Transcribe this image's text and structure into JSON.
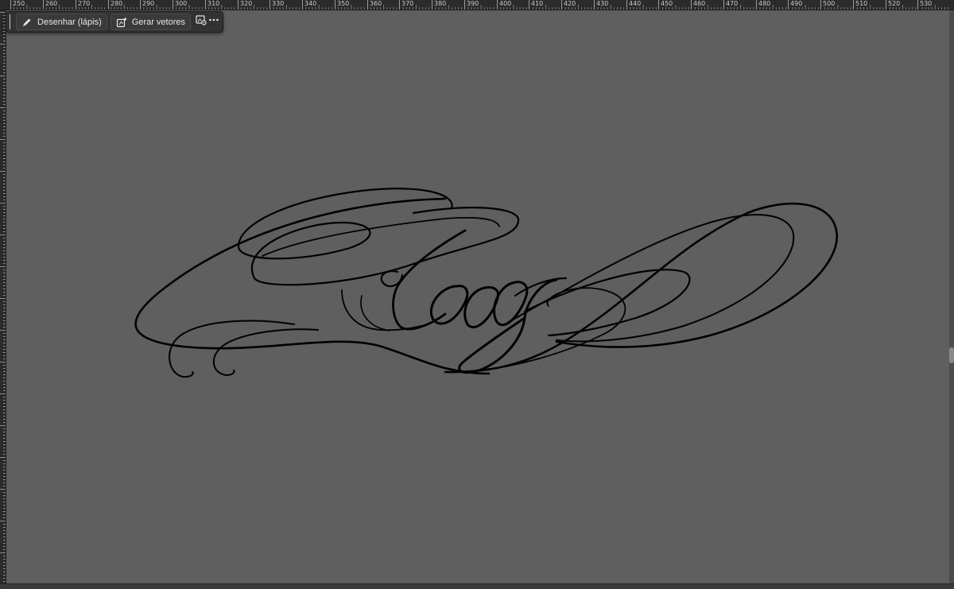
{
  "ruler": {
    "ticks": [
      "250",
      "260",
      "270",
      "280",
      "290",
      "300",
      "310",
      "320",
      "330",
      "340",
      "350",
      "360",
      "370",
      "380",
      "390",
      "400",
      "410",
      "420",
      "430",
      "440",
      "450",
      "460",
      "470",
      "480",
      "490",
      "500",
      "510",
      "520",
      "530"
    ]
  },
  "taskbar": {
    "draw_label": "Desenhar (lápis)",
    "draw_icon": "pencil-icon",
    "vectorize_label": "Gerar vetores",
    "vectorize_icon": "generate-vector-icon",
    "image_settings_icon": "image-settings-icon",
    "more_icon": "more-options-icon"
  },
  "canvas": {
    "background": "#5f5f5f",
    "stroke_color": "#000000",
    "content": "calligraphic-signature-drawing"
  },
  "colors": {
    "ruler_bg": "#2b2b2b",
    "ruler_text": "#c9c9c9",
    "taskbar_bg": "#323232",
    "button_text": "#e6e6e6"
  }
}
